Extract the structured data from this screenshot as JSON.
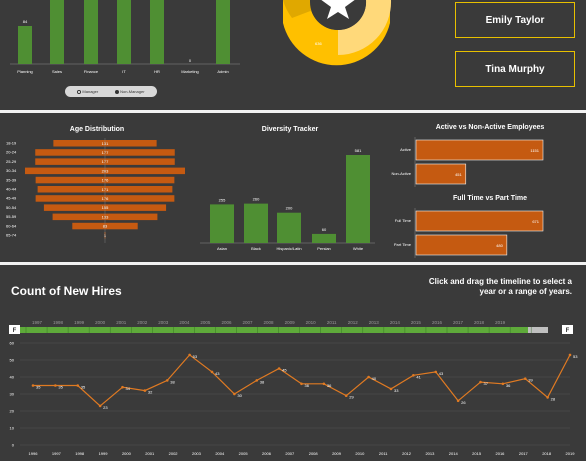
{
  "top": {
    "bar_chart": {
      "categories": [
        "Planning",
        "Sales",
        "Finance",
        "IT",
        "HR",
        "Marketing",
        "Admin"
      ],
      "first_label": "84",
      "marketing_label": "0",
      "legend": [
        "Manager",
        "Non-Manager"
      ]
    },
    "names": [
      "Emily Taylor",
      "Tina Murphy"
    ],
    "donut": {
      "label": "636",
      "icon": "star-icon"
    }
  },
  "age_distribution": {
    "title": "Age Distribution",
    "groups": [
      {
        "label": "18-19",
        "value": 131
      },
      {
        "label": "20-24",
        "value": 177
      },
      {
        "label": "25-29",
        "value": 177
      },
      {
        "label": "30-34",
        "value": 203
      },
      {
        "label": "35-39",
        "value": 176
      },
      {
        "label": "40-44",
        "value": 171
      },
      {
        "label": "45-49",
        "value": 176
      },
      {
        "label": "50-54",
        "value": 155
      },
      {
        "label": "55-59",
        "value": 133
      },
      {
        "label": "60-64",
        "value": 83
      },
      {
        "label": "65-74",
        "value": 1
      }
    ]
  },
  "diversity": {
    "title": "Diversity Tracker",
    "categories": [
      "Asian",
      "Black",
      "Hispanic/Latin",
      "Persian",
      "White"
    ],
    "values": [
      255,
      260,
      200,
      60,
      581
    ]
  },
  "active": {
    "title": "Active vs Non-Active Employees",
    "rows": [
      {
        "label": "Active",
        "value": 1151
      },
      {
        "label": "Non-Active",
        "value": 451
      }
    ]
  },
  "fulltime": {
    "title": "Full Time vs Part Time",
    "rows": [
      {
        "label": "Full Time",
        "value": 671
      },
      {
        "label": "Part Time",
        "value": 480
      }
    ]
  },
  "new_hires": {
    "title": "Count of New Hires",
    "hint": "Click and drag the timeline to select a year or a range of years.",
    "timeline_years": [
      "1997",
      "1998",
      "1999",
      "2000",
      "2001",
      "2002",
      "2003",
      "2004",
      "2005",
      "2006",
      "2007",
      "2008",
      "2009",
      "2010",
      "2011",
      "2012",
      "2013",
      "2014",
      "2015",
      "2016",
      "2017",
      "2018",
      "2019"
    ],
    "timeline_end_year": "2019",
    "timeline_left_label": "F",
    "timeline_right_label": "F"
  },
  "chart_data": {
    "type": "line",
    "x": [
      "1996",
      "1997",
      "1998",
      "1999",
      "2000",
      "2001",
      "2002",
      "2003",
      "2004",
      "2005",
      "2006",
      "2007",
      "2008",
      "2009",
      "2010",
      "2011",
      "2012",
      "2013",
      "2014",
      "2015",
      "2016",
      "2017",
      "2018",
      "2019"
    ],
    "series": [
      {
        "values": [
          35,
          35,
          35,
          23,
          34,
          32,
          38,
          53,
          43,
          30,
          38,
          45,
          36,
          36,
          29,
          40,
          33,
          41,
          43,
          26,
          37,
          36,
          39,
          28,
          53
        ]
      }
    ],
    "ylim": [
      0,
      60
    ],
    "yticks": [
      0,
      10,
      20,
      30,
      40,
      50,
      60
    ],
    "color": "#e07a22"
  },
  "colors": {
    "green": "#4f8f33",
    "orange": "#c55a11",
    "gold": "#ffc000",
    "line": "#e07a22"
  }
}
